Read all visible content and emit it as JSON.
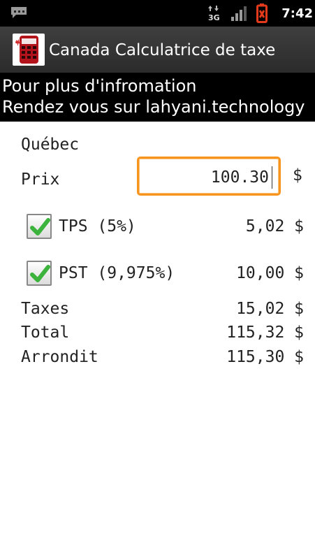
{
  "status_bar": {
    "time": "7:42",
    "network_label": "3G",
    "icons": [
      "message-icon",
      "network-3g-icon",
      "signal-icon",
      "battery-alert-icon"
    ]
  },
  "app": {
    "title": "Canada Calculatrice de taxe",
    "icon": "calculator-icon"
  },
  "banner": {
    "line1": "Pour plus d'infromation",
    "line2": "Rendez vous sur lahyani.technology"
  },
  "form": {
    "province": "Québec",
    "price_label": "Prix",
    "price_value": "100.30",
    "currency": "$"
  },
  "taxes": [
    {
      "label": "TPS (5%)",
      "checked": true,
      "amount": "5,02 $"
    },
    {
      "label": "PST (9,975%)",
      "checked": true,
      "amount": "10,00 $"
    }
  ],
  "summary": [
    {
      "label": "Taxes",
      "amount": "15,02 $"
    },
    {
      "label": "Total",
      "amount": "115,32 $"
    },
    {
      "label": "Arrondit",
      "amount": "115,30 $"
    }
  ],
  "colors": {
    "accent_focus": "#f7941d",
    "check_green": "#3cb33c",
    "icon_red": "#d32f2f"
  }
}
